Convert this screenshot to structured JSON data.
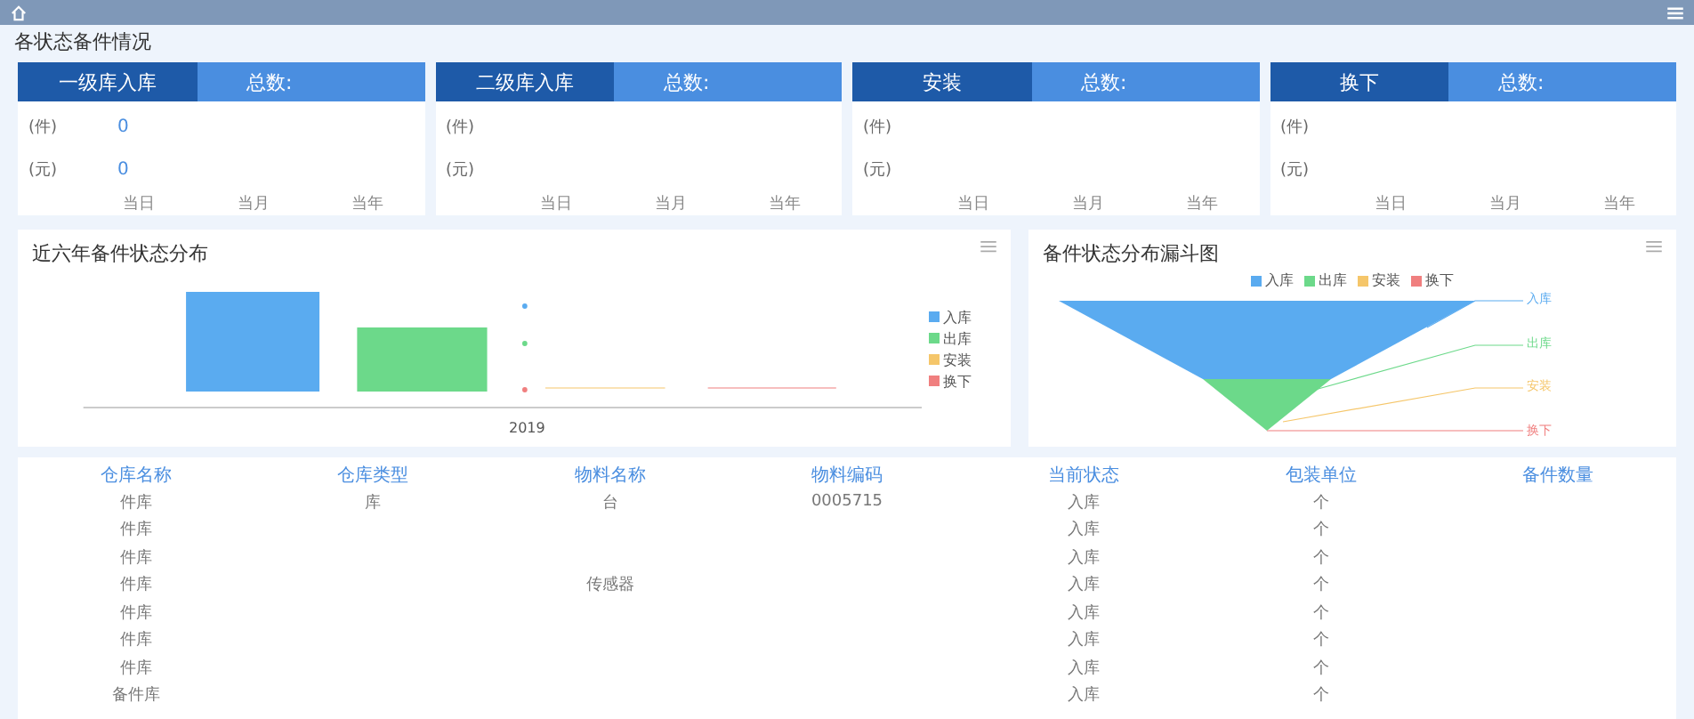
{
  "section_title": "各状态备件情况",
  "cards": [
    {
      "label": "一级库入库",
      "total_label": "总数:",
      "rows": [
        {
          "unit": "(件)",
          "value": "0"
        },
        {
          "unit": "(元)",
          "value": "0"
        }
      ],
      "periods": [
        "当日",
        "当月",
        "当年"
      ]
    },
    {
      "label": "二级库入库",
      "total_label": "总数:",
      "rows": [
        {
          "unit": "(件)"
        },
        {
          "unit": "(元)"
        }
      ],
      "periods": [
        "当日",
        "当月",
        "当年"
      ]
    },
    {
      "label": "安装",
      "total_label": "总数:",
      "rows": [
        {
          "unit": "(件)"
        },
        {
          "unit": "(元)"
        }
      ],
      "periods": [
        "当日",
        "当月",
        "当年"
      ]
    },
    {
      "label": "换下",
      "total_label": "总数:",
      "rows": [
        {
          "unit": "(件)"
        },
        {
          "unit": "(元)"
        }
      ],
      "periods": [
        "当日",
        "当月",
        "当年"
      ]
    }
  ],
  "bar_panel": {
    "title": "近六年备件状态分布",
    "x_label": "2019",
    "legend": [
      {
        "name": "入库",
        "color": "#5aabf0"
      },
      {
        "name": "出库",
        "color": "#6cd98a"
      },
      {
        "name": "安装",
        "color": "#f5c66a"
      },
      {
        "name": "换下",
        "color": "#f07f7f"
      }
    ]
  },
  "funnel_panel": {
    "title": "备件状态分布漏斗图",
    "legend": [
      {
        "name": "入库",
        "color": "#5aabf0"
      },
      {
        "name": "出库",
        "color": "#6cd98a"
      },
      {
        "name": "安装",
        "color": "#f5c66a"
      },
      {
        "name": "换下",
        "color": "#f07f7f"
      }
    ],
    "stage_labels": [
      "入库",
      "出库",
      "安装",
      "换下"
    ]
  },
  "table": {
    "columns": [
      "仓库名称",
      "仓库类型",
      "物料名称",
      "物料编码",
      "当前状态",
      "包装单位",
      "备件数量"
    ],
    "rows": [
      [
        "件库",
        "库",
        "台",
        "0005715",
        "入库",
        "个"
      ],
      [
        "件库",
        "",
        "",
        "",
        "入库",
        "个"
      ],
      [
        "件库",
        "",
        "",
        "",
        "入库",
        "个"
      ],
      [
        "件库",
        "",
        "传感器",
        "",
        "入库",
        "个"
      ],
      [
        "件库",
        "",
        "",
        "",
        "入库",
        "个"
      ],
      [
        "件库",
        "",
        "",
        "",
        "入库",
        "个"
      ],
      [
        "件库",
        "",
        "",
        "",
        "入库",
        "个"
      ],
      [
        "备件库",
        "",
        "",
        "",
        "入库",
        "个"
      ]
    ]
  }
}
